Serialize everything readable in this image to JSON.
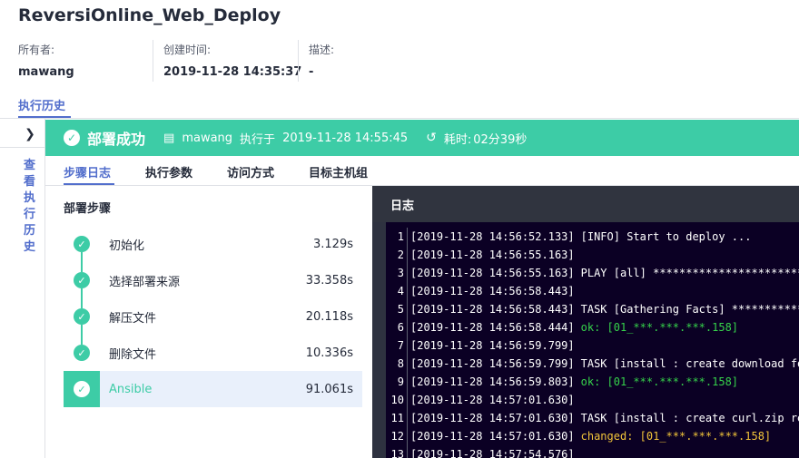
{
  "app_title": "ReversiOnline_Web_Deploy",
  "meta": {
    "owner_label": "所有者:",
    "owner_value": "mawang",
    "created_label": "创建时间:",
    "created_value": "2019-11-28 14:35:37",
    "desc_label": "描述:",
    "desc_value": "-"
  },
  "tabs": {
    "history": "执行历史"
  },
  "sidebar": {
    "view_history": "查看执行历史"
  },
  "status": {
    "title": "部署成功",
    "user": "mawang",
    "executed_at_label": "执行于",
    "executed_at": "2019-11-28 14:55:45",
    "duration_label": "耗时:",
    "duration": "02分39秒"
  },
  "subtabs": [
    "步骤日志",
    "执行参数",
    "访问方式",
    "目标主机组"
  ],
  "steps_title": "部署步骤",
  "steps": [
    {
      "name": "初始化",
      "time": "3.129s"
    },
    {
      "name": "选择部署来源",
      "time": "33.358s"
    },
    {
      "name": "解压文件",
      "time": "20.118s"
    },
    {
      "name": "删除文件",
      "time": "10.336s"
    },
    {
      "name": "Ansible",
      "time": "91.061s"
    }
  ],
  "log": {
    "title": "日志",
    "lines": [
      {
        "no": "1",
        "ts": "[2019-11-28 14:56:52.133]",
        "msg": "[INFO]  Start to deploy ...",
        "kind": ""
      },
      {
        "no": "2",
        "ts": "[2019-11-28 14:56:55.163]",
        "msg": "",
        "kind": ""
      },
      {
        "no": "3",
        "ts": "[2019-11-28 14:56:55.163]",
        "msg": "PLAY [all] ******************************",
        "kind": ""
      },
      {
        "no": "4",
        "ts": "[2019-11-28 14:56:58.443]",
        "msg": "",
        "kind": ""
      },
      {
        "no": "5",
        "ts": "[2019-11-28 14:56:58.443]",
        "msg": "TASK [Gathering Facts] ****************",
        "kind": ""
      },
      {
        "no": "6",
        "ts": "[2019-11-28 14:56:58.444]",
        "msg": "ok: [01_***.***.***.158]",
        "kind": "ok"
      },
      {
        "no": "7",
        "ts": "[2019-11-28 14:56:59.799]",
        "msg": "",
        "kind": ""
      },
      {
        "no": "8",
        "ts": "[2019-11-28 14:56:59.799]",
        "msg": "TASK [install : create download folde",
        "kind": ""
      },
      {
        "no": "9",
        "ts": "[2019-11-28 14:56:59.803]",
        "msg": "ok: [01_***.***.***.158]",
        "kind": "ok"
      },
      {
        "no": "10",
        "ts": "[2019-11-28 14:57:01.630]",
        "msg": "",
        "kind": ""
      },
      {
        "no": "11",
        "ts": "[2019-11-28 14:57:01.630]",
        "msg": "TASK [install : create curl.zip repos",
        "kind": ""
      },
      {
        "no": "12",
        "ts": "[2019-11-28 14:57:01.630]",
        "msg": "changed: [01_***.***.***.158]",
        "kind": "changed"
      },
      {
        "no": "13",
        "ts": "[2019-11-28 14:57:54.576]",
        "msg": "",
        "kind": ""
      }
    ]
  }
}
